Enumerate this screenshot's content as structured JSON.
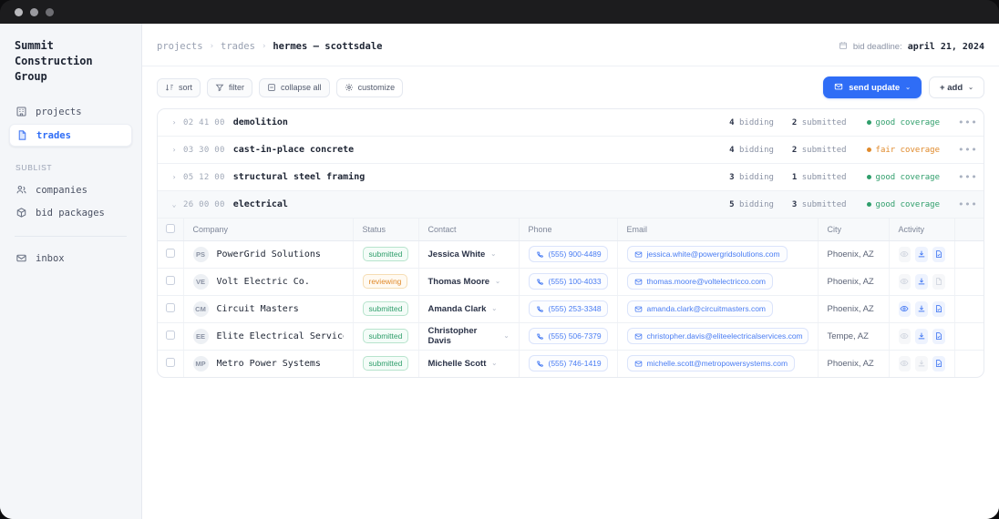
{
  "window": {
    "dots": [
      "close",
      "minimize",
      "maximize"
    ]
  },
  "sidebar": {
    "brand": "Summit Construction Group",
    "items": [
      {
        "label": "projects",
        "icon": "building-icon",
        "active": false
      },
      {
        "label": "trades",
        "icon": "file-icon",
        "active": true
      }
    ],
    "section_label": "SUBLIST",
    "sub_items": [
      {
        "label": "companies",
        "icon": "users-icon"
      },
      {
        "label": "bid packages",
        "icon": "package-icon"
      }
    ],
    "footer_items": [
      {
        "label": "inbox",
        "icon": "inbox-icon"
      }
    ]
  },
  "header": {
    "breadcrumb": [
      {
        "label": "projects",
        "current": false
      },
      {
        "label": "trades",
        "current": false
      },
      {
        "label": "hermes — scottsdale",
        "current": true
      }
    ],
    "separator": "›",
    "deadline_icon": "calendar-icon",
    "deadline_label": "bid deadline:",
    "deadline_value": "april 21, 2024"
  },
  "toolbar": {
    "buttons": [
      {
        "label": "sort",
        "icon": "sort-icon"
      },
      {
        "label": "filter",
        "icon": "funnel-icon"
      },
      {
        "label": "collapse all",
        "icon": "collapse-icon"
      },
      {
        "label": "customize",
        "icon": "gear-icon"
      }
    ],
    "primary": {
      "label": "send update",
      "icon": "envelope-icon",
      "caret": "⌄",
      "color": "#2f6df6"
    },
    "secondary": {
      "label": "+ add",
      "caret": "⌄"
    }
  },
  "trades": [
    {
      "code": "02 41 00",
      "name": "demolition",
      "expanded": false,
      "chevron": "›",
      "bidding_count": "4",
      "bidding_label": "bidding",
      "submitted_count": "2",
      "submitted_label": "submitted",
      "coverage": "good coverage",
      "coverage_color": "#2f9e6b",
      "kebab": "•••"
    },
    {
      "code": "03 30 00",
      "name": "cast-in-place concrete",
      "expanded": false,
      "chevron": "›",
      "bidding_count": "4",
      "bidding_label": "bidding",
      "submitted_count": "2",
      "submitted_label": "submitted",
      "coverage": "fair coverage",
      "coverage_color": "#e08a2b",
      "kebab": "•••"
    },
    {
      "code": "05 12 00",
      "name": "structural steel framing",
      "expanded": false,
      "chevron": "›",
      "bidding_count": "3",
      "bidding_label": "bidding",
      "submitted_count": "1",
      "submitted_label": "submitted",
      "coverage": "good coverage",
      "coverage_color": "#2f9e6b",
      "kebab": "•••"
    },
    {
      "code": "26 00 00",
      "name": "electrical",
      "expanded": true,
      "chevron": "⌄",
      "bidding_count": "5",
      "bidding_label": "bidding",
      "submitted_count": "3",
      "submitted_label": "submitted",
      "coverage": "good coverage",
      "coverage_color": "#2f9e6b",
      "kebab": "•••"
    }
  ],
  "table": {
    "columns": [
      "Company",
      "Status",
      "Contact",
      "Phone",
      "Email",
      "City",
      "Activity"
    ],
    "rows": [
      {
        "initials": "PS",
        "company": "PowerGrid Solutions",
        "status": "submitted",
        "status_kind": "submitted",
        "contact": "Jessica White",
        "contact_caret": "⌄",
        "phone": "(555) 900-4489",
        "email": "jessica.white@powergridsolutions.com",
        "city": "Phoenix, AZ",
        "activity": {
          "view": false,
          "download": true,
          "document": true
        }
      },
      {
        "initials": "VE",
        "company": "Volt Electric Co.",
        "status": "reviewing",
        "status_kind": "reviewing",
        "contact": "Thomas Moore",
        "contact_caret": "⌄",
        "phone": "(555) 100-4033",
        "email": "thomas.moore@voltelectricco.com",
        "city": "Phoenix, AZ",
        "activity": {
          "view": false,
          "download": true,
          "document": false
        }
      },
      {
        "initials": "CM",
        "company": "Circuit Masters",
        "status": "submitted",
        "status_kind": "submitted",
        "contact": "Amanda Clark",
        "contact_caret": "⌄",
        "phone": "(555) 253-3348",
        "email": "amanda.clark@circuitmasters.com",
        "city": "Phoenix, AZ",
        "activity": {
          "view": true,
          "download": true,
          "document": true
        }
      },
      {
        "initials": "EE",
        "company": "Elite Electrical Services",
        "status": "submitted",
        "status_kind": "submitted",
        "contact": "Christopher Davis",
        "contact_caret": "⌄",
        "phone": "(555) 506-7379",
        "email": "christopher.davis@eliteelectricalservices.com",
        "city": "Tempe, AZ",
        "activity": {
          "view": false,
          "download": true,
          "document": true
        }
      },
      {
        "initials": "MP",
        "company": "Metro Power Systems",
        "status": "submitted",
        "status_kind": "submitted",
        "contact": "Michelle Scott",
        "contact_caret": "⌄",
        "phone": "(555) 746-1419",
        "email": "michelle.scott@metropowersystems.com",
        "city": "Phoenix, AZ",
        "activity": {
          "view": false,
          "download": false,
          "document": true
        }
      }
    ]
  }
}
